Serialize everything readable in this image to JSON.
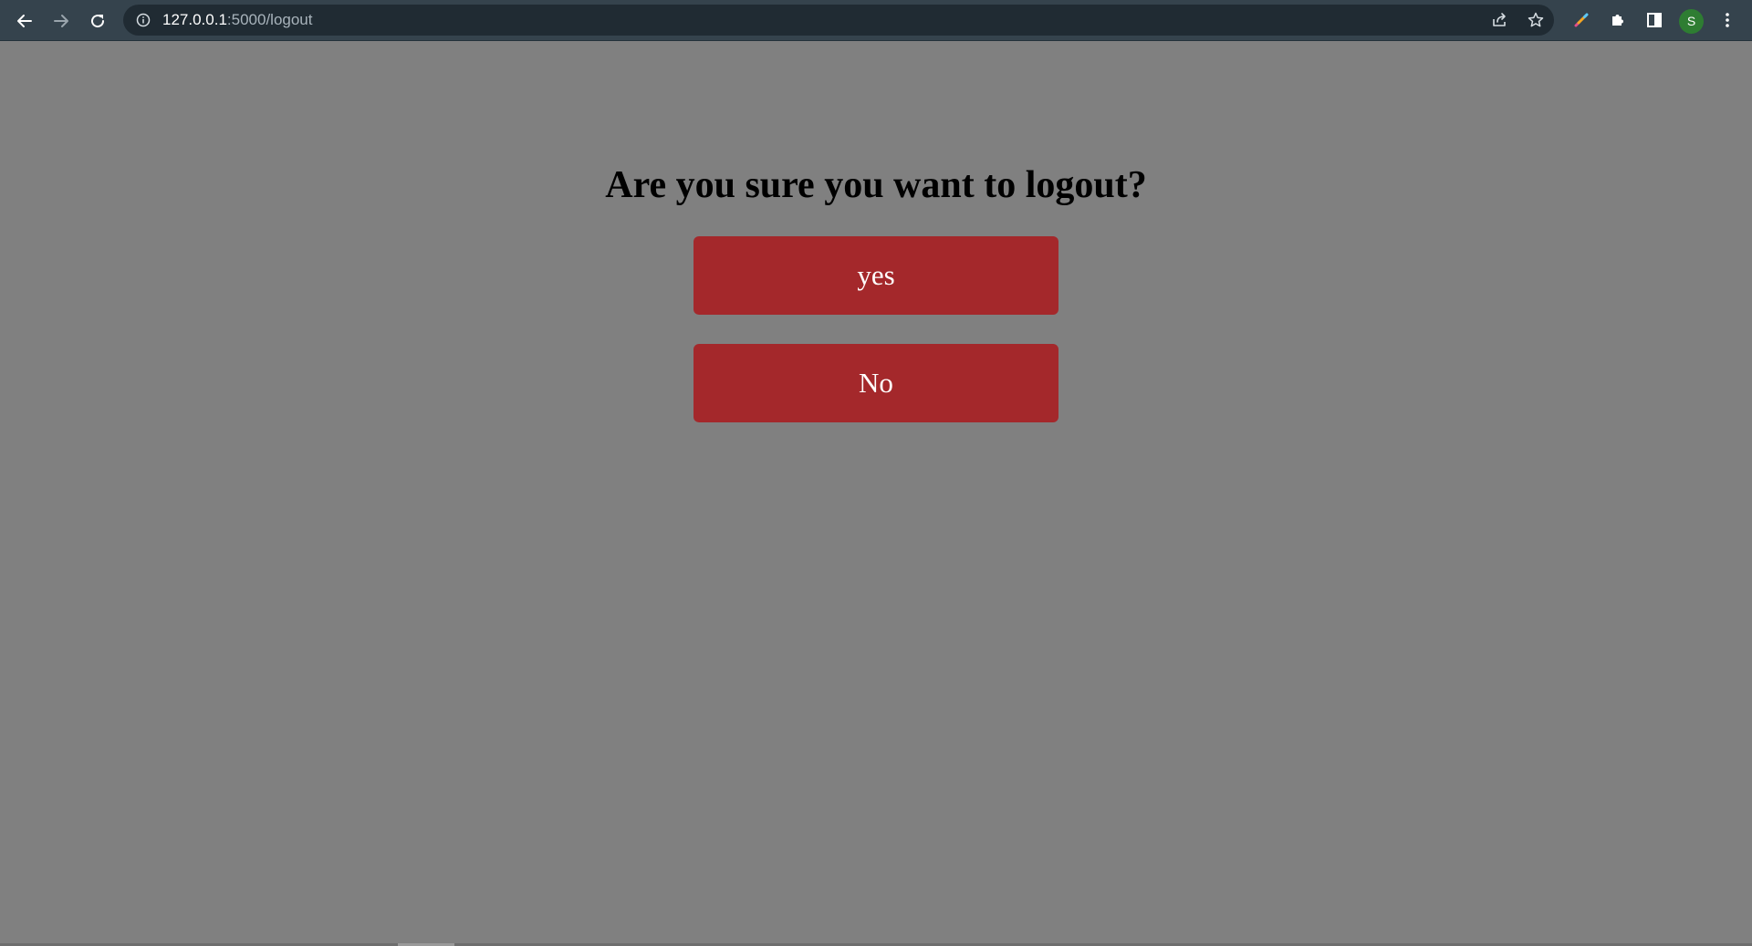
{
  "browser": {
    "url_host": "127.0.0.1",
    "url_path": ":5000/logout",
    "profile_initial": "S",
    "icons": {
      "back": "back-arrow-icon",
      "forward": "forward-arrow-icon",
      "reload": "reload-icon",
      "site_info": "info-icon",
      "share": "share-icon",
      "bookmark": "star-icon",
      "pen_extension": "pen-icon",
      "extensions": "puzzle-icon",
      "side_panel": "side-panel-icon",
      "menu": "kebab-menu-icon"
    }
  },
  "page": {
    "title": "Are you sure you want to logout?",
    "yes_label": "yes",
    "no_label": "No"
  },
  "colors": {
    "page_background": "#808080",
    "button_background": "#a4282b",
    "button_text": "#ffffff",
    "toolbar_background": "#35434d"
  }
}
